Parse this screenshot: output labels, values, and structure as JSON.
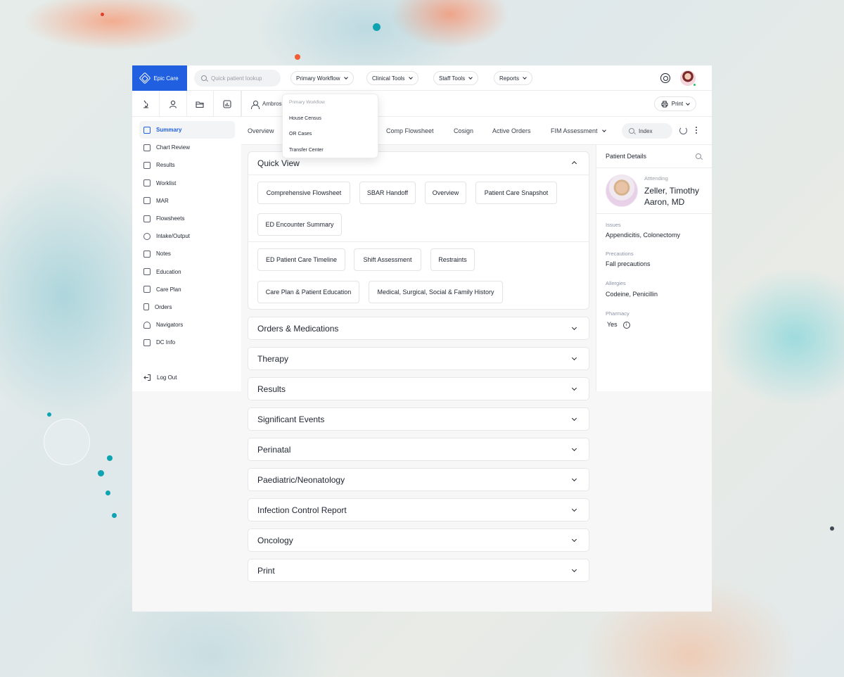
{
  "app": {
    "brand": "Epic Care"
  },
  "topbar": {
    "search_placeholder": "Quick patient lookup",
    "menus": [
      "Primary Workflow",
      "Clinical Tools",
      "Staff Tools",
      "Reports"
    ]
  },
  "dropdown": {
    "header": "Primary Workflow",
    "items": [
      "House Census",
      "OR Cases",
      "Transfer Center"
    ]
  },
  "patient_tab": {
    "name": "Ambros"
  },
  "print_label": "Print",
  "sidebar": {
    "items": [
      {
        "label": "Summary",
        "icon": "grid-icon"
      },
      {
        "label": "Chart Review",
        "icon": "chart-icon"
      },
      {
        "label": "Results",
        "icon": "document-icon"
      },
      {
        "label": "Worklist",
        "icon": "worklist-icon"
      },
      {
        "label": "MAR",
        "icon": "mar-icon"
      },
      {
        "label": "Flowsheets",
        "icon": "flowsheet-icon"
      },
      {
        "label": "Intake/Output",
        "icon": "stethoscope-icon"
      },
      {
        "label": "Notes",
        "icon": "notes-icon"
      },
      {
        "label": "Education",
        "icon": "education-icon"
      },
      {
        "label": "Care Plan",
        "icon": "care-plan-icon"
      },
      {
        "label": "Orders",
        "icon": "orders-icon"
      },
      {
        "label": "Navigators",
        "icon": "navigator-icon"
      },
      {
        "label": "DC Info",
        "icon": "dc-info-icon"
      }
    ],
    "logout": "Log Out"
  },
  "tabs": [
    "Overview",
    "Comp Flowsheet",
    "Cosign",
    "Active Orders",
    "FIM Assessment"
  ],
  "index_search": "Index",
  "quick_view": {
    "title": "Quick View",
    "buttons": [
      "Comprehensive Flowsheet",
      "SBAR Handoff",
      "Overview",
      "Patient Care Snapshot",
      "ED Encounter Summary",
      "ED Patient Care Timeline",
      "Shift Assessment",
      "Restraints",
      "Care Plan & Patient Education",
      "Medical, Surgical, Social & Family History"
    ]
  },
  "sections": [
    "Orders & Medications",
    "Therapy",
    "Results",
    "Significant Events",
    "Perinatal",
    "Paediatric/Neonatology",
    "Infection Control Report",
    "Oncology",
    "Print"
  ],
  "patient_details": {
    "title": "Patient Details",
    "attending_label": "Atttending",
    "attending_name": "Zeller, Timothy Aaron, MD",
    "issues_label": "Issues",
    "issues": "Appendicitis, Colonectomy",
    "precautions_label": "Precautions",
    "precautions": "Fall precautions",
    "allergies_label": "Allergies",
    "allergies": "Codeine, Penicillin",
    "pharmacy_label": "Pharmacy",
    "pharmacy": "Yes"
  },
  "colors": {
    "brand": "#1f5fe0",
    "online": "#22c55e"
  }
}
